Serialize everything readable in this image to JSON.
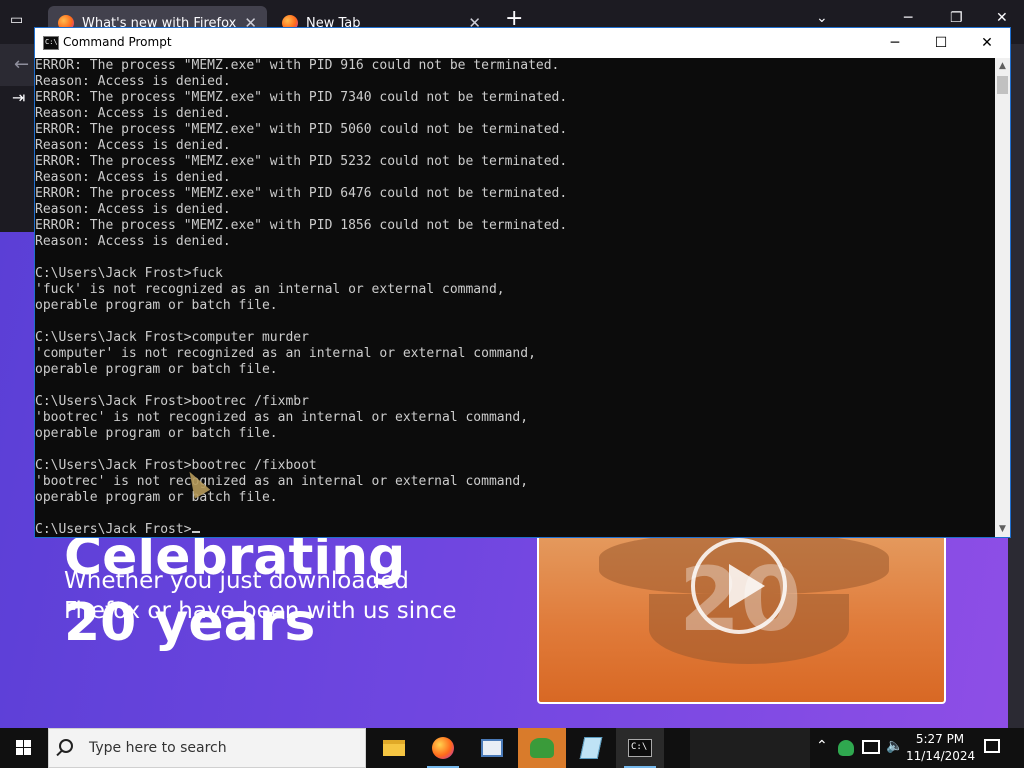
{
  "firefox": {
    "tabs": [
      {
        "label": "What's new with Firefox"
      },
      {
        "label": "New Tab"
      }
    ],
    "page": {
      "heading_line1": "Celebrating",
      "heading_line2": "20 years",
      "subtext_line1": "Whether you just downloaded",
      "subtext_line2": "Firefox or have been with us since"
    }
  },
  "cmd": {
    "title": "Command Prompt",
    "lines": [
      "ERROR: The process \"MEMZ.exe\" with PID 916 could not be terminated.",
      "Reason: Access is denied.",
      "ERROR: The process \"MEMZ.exe\" with PID 7340 could not be terminated.",
      "Reason: Access is denied.",
      "ERROR: The process \"MEMZ.exe\" with PID 5060 could not be terminated.",
      "Reason: Access is denied.",
      "ERROR: The process \"MEMZ.exe\" with PID 5232 could not be terminated.",
      "Reason: Access is denied.",
      "ERROR: The process \"MEMZ.exe\" with PID 6476 could not be terminated.",
      "Reason: Access is denied.",
      "ERROR: The process \"MEMZ.exe\" with PID 1856 could not be terminated.",
      "Reason: Access is denied.",
      "",
      "C:\\Users\\Jack Frost>fuck",
      "'fuck' is not recognized as an internal or external command,",
      "operable program or batch file.",
      "",
      "C:\\Users\\Jack Frost>computer murder",
      "'computer' is not recognized as an internal or external command,",
      "operable program or batch file.",
      "",
      "C:\\Users\\Jack Frost>bootrec /fixmbr",
      "'bootrec' is not recognized as an internal or external command,",
      "operable program or batch file.",
      "",
      "C:\\Users\\Jack Frost>bootrec /fixboot",
      "'bootrec' is not recognized as an internal or external command,",
      "operable program or batch file.",
      "",
      "C:\\Users\\Jack Frost>"
    ],
    "colors": {
      "background": "#0c0c0c",
      "text": "#cccccc"
    }
  },
  "taskbar": {
    "search_placeholder": "Type here to search",
    "apps": [
      {
        "name": "file-explorer-icon"
      },
      {
        "name": "firefox-icon"
      },
      {
        "name": "app-window-icon"
      },
      {
        "name": "people-app-icon"
      },
      {
        "name": "notepad-icon"
      },
      {
        "name": "command-prompt-icon"
      }
    ],
    "clock_time": "5:27 PM",
    "clock_date": "11/14/2024",
    "accent_color": "#d97b2b"
  }
}
